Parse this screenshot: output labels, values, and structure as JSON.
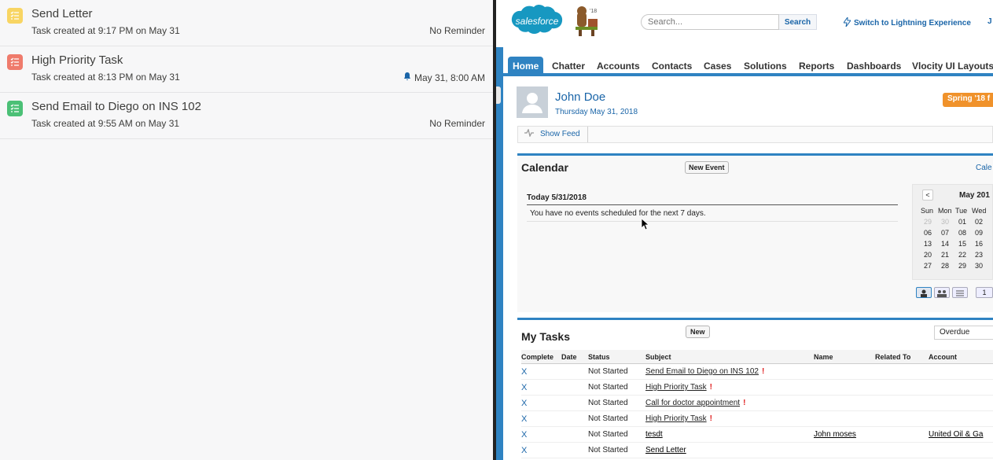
{
  "left_tasks": [
    {
      "title": "Send Letter",
      "subtitle": "Task created at 9:17 PM on May 31",
      "reminder": "No Reminder",
      "color": "#f8d563",
      "icon": "task-list-icon",
      "has_bell": false
    },
    {
      "title": "High Priority Task",
      "subtitle": "Task created at 8:13 PM on May 31",
      "reminder": "May 31, 8:00 AM",
      "color": "#ef7b6c",
      "icon": "task-list-icon",
      "has_bell": true
    },
    {
      "title": "Send Email to Diego on INS 102",
      "subtitle": "Task created at 9:55 AM on May 31",
      "reminder": "No Reminder",
      "color": "#4bc076",
      "icon": "task-list-icon",
      "has_bell": false
    }
  ],
  "header": {
    "logo_text": "salesforce",
    "mascot_badge": "'18",
    "search_placeholder": "Search...",
    "search_button": "Search",
    "lightning_link": "Switch to Lightning Experience",
    "more_link": "J"
  },
  "tabs": [
    {
      "label": "Home",
      "active": true
    },
    {
      "label": "Chatter"
    },
    {
      "label": "Accounts"
    },
    {
      "label": "Contacts"
    },
    {
      "label": "Cases"
    },
    {
      "label": "Solutions"
    },
    {
      "label": "Reports"
    },
    {
      "label": "Dashboards"
    },
    {
      "label": "Vlocity UI Layouts"
    }
  ],
  "user": {
    "name": "John Doe",
    "date": "Thursday May 31, 2018",
    "release_badge": "Spring '18 f"
  },
  "feed": {
    "show_feed": "Show Feed"
  },
  "calendar": {
    "title": "Calendar",
    "new_event": "New Event",
    "link": "Cale",
    "today_label": "Today 5/31/2018",
    "no_events": "You have no events scheduled for the next 7 days.",
    "month_label": "May 201",
    "prev": "<",
    "dow": [
      "Sun",
      "Mon",
      "Tue",
      "Wed"
    ],
    "weeks": [
      [
        "29",
        "30",
        "01",
        "02"
      ],
      [
        "06",
        "07",
        "08",
        "09"
      ],
      [
        "13",
        "14",
        "15",
        "16"
      ],
      [
        "20",
        "21",
        "22",
        "23"
      ],
      [
        "27",
        "28",
        "29",
        "30"
      ]
    ],
    "view_last": "1"
  },
  "tasks": {
    "title": "My Tasks",
    "new_button": "New",
    "filter": "Overdue",
    "columns": [
      "Complete",
      "Date",
      "Status",
      "Subject",
      "Name",
      "Related To",
      "Account"
    ],
    "rows": [
      {
        "complete": "X",
        "status": "Not Started",
        "subject": "Send Email to Diego on INS 102",
        "priority": true,
        "name": "",
        "account": ""
      },
      {
        "complete": "X",
        "status": "Not Started",
        "subject": "High Priority Task",
        "priority": true,
        "name": "",
        "account": ""
      },
      {
        "complete": "X",
        "status": "Not Started",
        "subject": "Call for doctor appointment",
        "priority": true,
        "name": "",
        "account": ""
      },
      {
        "complete": "X",
        "status": "Not Started",
        "subject": "High Priority Task",
        "priority": true,
        "name": "",
        "account": ""
      },
      {
        "complete": "X",
        "status": "Not Started",
        "subject": "tesdt",
        "priority": false,
        "name": "John moses",
        "account": "United Oil & Ga"
      },
      {
        "complete": "X",
        "status": "Not Started",
        "subject": "Send Letter",
        "priority": false,
        "name": "",
        "account": ""
      }
    ],
    "priority_mark": "!"
  }
}
